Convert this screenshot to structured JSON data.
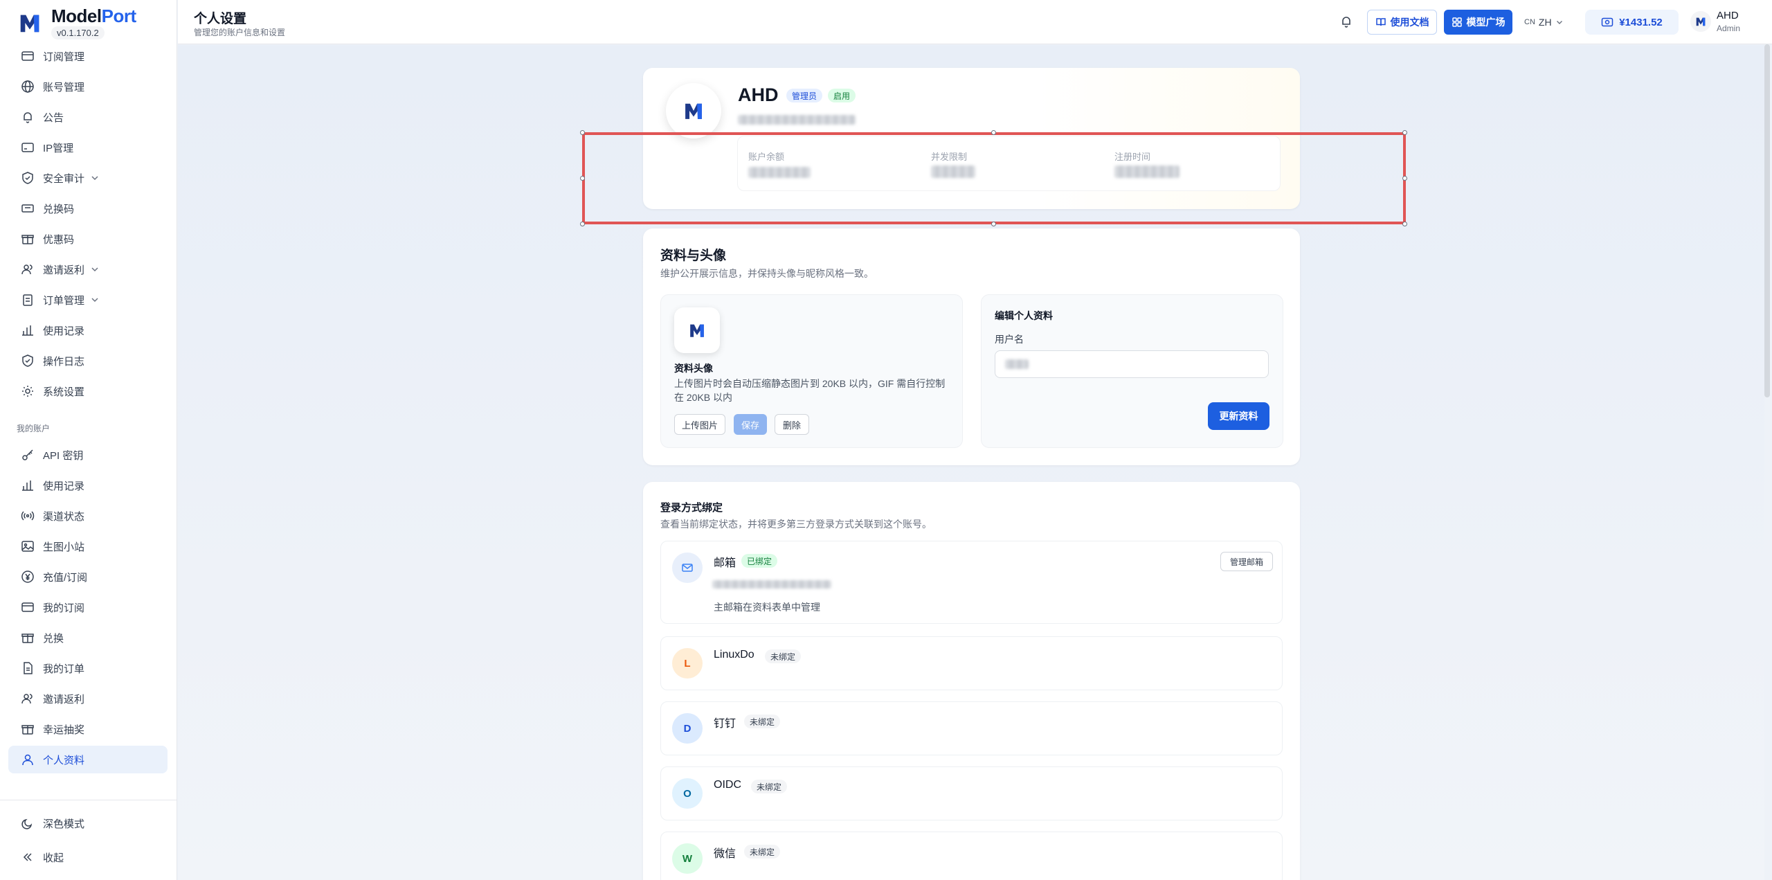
{
  "brand": {
    "name_left": "Model",
    "name_right": "Port",
    "version": "v0.1.170.2"
  },
  "sidebar": {
    "items": [
      {
        "label": "订阅管理",
        "icon": "card-icon"
      },
      {
        "label": "账号管理",
        "icon": "globe-icon"
      },
      {
        "label": "公告",
        "icon": "bell-icon"
      },
      {
        "label": "IP管理",
        "icon": "server-icon"
      },
      {
        "label": "安全审计",
        "icon": "shield-icon",
        "expandable": true
      },
      {
        "label": "兑换码",
        "icon": "ticket-icon"
      },
      {
        "label": "优惠码",
        "icon": "gift-icon"
      },
      {
        "label": "邀请返利",
        "icon": "users-icon",
        "expandable": true
      },
      {
        "label": "订单管理",
        "icon": "clipboard-icon",
        "expandable": true
      },
      {
        "label": "使用记录",
        "icon": "bar-chart-icon"
      },
      {
        "label": "操作日志",
        "icon": "shield-icon"
      },
      {
        "label": "系统设置",
        "icon": "gear-icon"
      }
    ],
    "section_label": "我的账户",
    "account_items": [
      {
        "label": "API 密钥",
        "icon": "key-icon"
      },
      {
        "label": "使用记录",
        "icon": "bar-chart-icon"
      },
      {
        "label": "渠道状态",
        "icon": "signal-icon"
      },
      {
        "label": "生图小站",
        "icon": "image-icon"
      },
      {
        "label": "充值/订阅",
        "icon": "yuan-icon"
      },
      {
        "label": "我的订阅",
        "icon": "card-icon"
      },
      {
        "label": "兑换",
        "icon": "gift-icon"
      },
      {
        "label": "我的订单",
        "icon": "doc-icon"
      },
      {
        "label": "邀请返利",
        "icon": "users-icon"
      },
      {
        "label": "幸运抽奖",
        "icon": "gift-icon"
      },
      {
        "label": "个人资料",
        "icon": "user-icon",
        "active": true
      }
    ],
    "dark_mode": "深色模式",
    "collapse": "收起"
  },
  "header": {
    "title": "个人设置",
    "subtitle": "管理您的账户信息和设置",
    "docs_label": "使用文档",
    "models_label": "模型广场",
    "lang_prefix": "CN",
    "lang": "ZH",
    "balance": "¥1431.52",
    "user_name": "AHD",
    "user_role": "Admin"
  },
  "profile": {
    "name": "AHD",
    "badge_role": "管理员",
    "badge_status": "启用",
    "stats": [
      {
        "label": "账户余额"
      },
      {
        "label": "并发限制"
      },
      {
        "label": "注册时间"
      }
    ]
  },
  "info": {
    "title": "资料与头像",
    "desc": "维护公开展示信息，并保持头像与昵称风格一致。",
    "avatar_title": "资料头像",
    "avatar_desc": "上传图片时会自动压缩静态图片到 20KB 以内，GIF 需自行控制在 20KB 以内",
    "upload_label": "上传图片",
    "save_label": "保存",
    "delete_label": "删除",
    "edit_title": "编辑个人资料",
    "username_label": "用户名",
    "update_label": "更新资料"
  },
  "bindings": {
    "title": "登录方式绑定",
    "desc": "查看当前绑定状态，并将更多第三方登录方式关联到这个账号。",
    "email": {
      "name": "邮箱",
      "status": "已绑定",
      "note": "主邮箱在资料表单中管理",
      "action": "管理邮箱"
    },
    "items": [
      {
        "letter": "L",
        "name": "LinuxDo",
        "status": "未绑定"
      },
      {
        "letter": "D",
        "name": "钉钉",
        "status": "未绑定"
      },
      {
        "letter": "O",
        "name": "OIDC",
        "status": "未绑定"
      },
      {
        "letter": "W",
        "name": "微信",
        "status": "未绑定"
      }
    ]
  },
  "colors": {
    "accent": "#1d5fe0",
    "selection": "#e05555",
    "bound": "#15803d"
  }
}
